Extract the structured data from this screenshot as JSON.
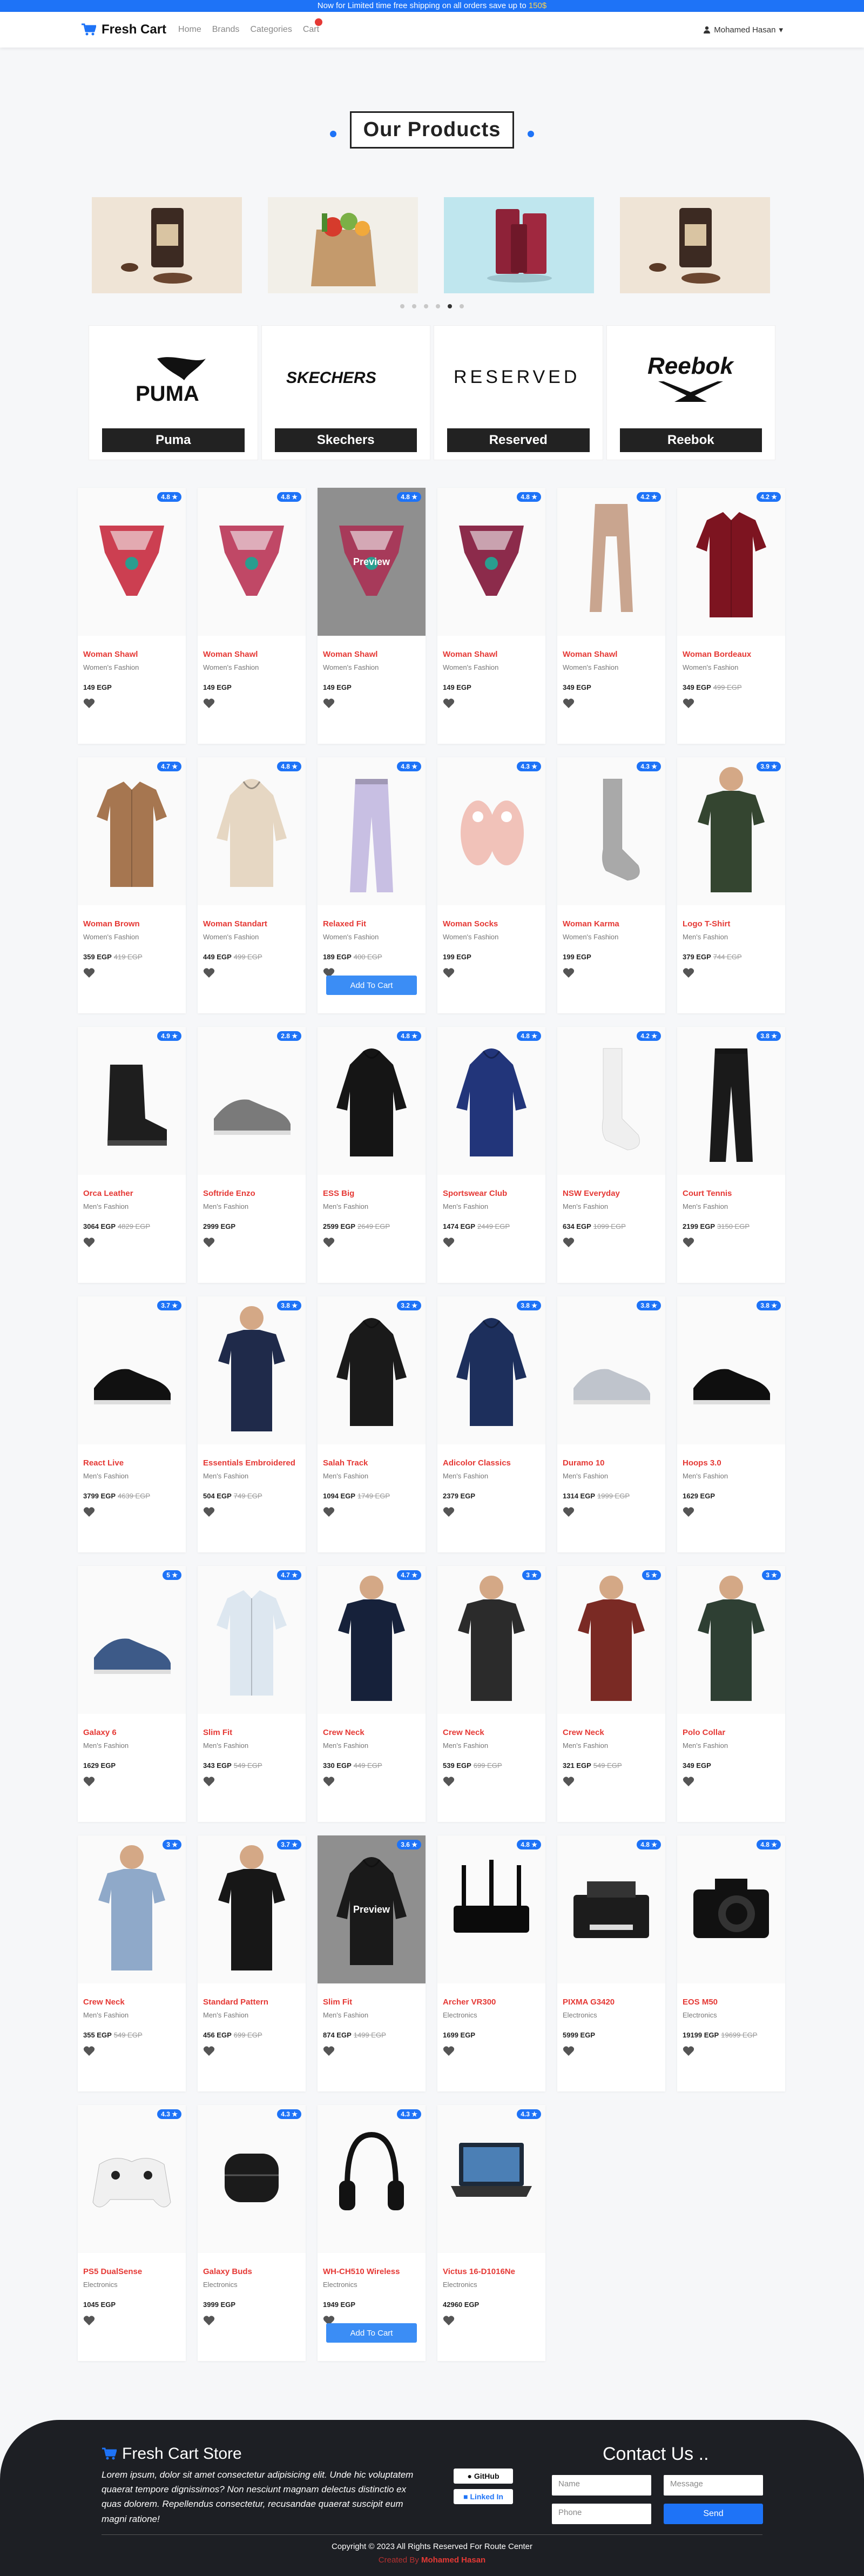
{
  "topbar": {
    "text": "Now for Limited time free shipping on all orders save up to ",
    "highlight": "150$"
  },
  "nav": {
    "brand": "Fresh Cart",
    "links": [
      "Home",
      "Brands",
      "Categories",
      "Cart"
    ],
    "user": "Mohamed Hasan"
  },
  "section_title": "Our Products",
  "slider": {
    "dots": 6,
    "active_dot": 4
  },
  "brands": [
    "Puma",
    "Skechers",
    "Reserved",
    "Reebok"
  ],
  "products": [
    {
      "name": "Woman Shawl",
      "category": "Women's Fashion",
      "price": "149 EGP",
      "old": "",
      "rating": "4.8",
      "kind": "shawl",
      "color": "#cc3f51"
    },
    {
      "name": "Woman Shawl",
      "category": "Women's Fashion",
      "price": "149 EGP",
      "old": "",
      "rating": "4.8",
      "kind": "shawl",
      "color": "#c04866"
    },
    {
      "name": "Woman Shawl",
      "category": "Women's Fashion",
      "price": "149 EGP",
      "old": "",
      "rating": "4.8",
      "kind": "shawl",
      "color": "#a73a5a",
      "preview": true
    },
    {
      "name": "Woman Shawl",
      "category": "Women's Fashion",
      "price": "149 EGP",
      "old": "",
      "rating": "4.8",
      "kind": "shawl",
      "color": "#8c2b4b"
    },
    {
      "name": "Woman Shawl",
      "category": "Women's Fashion",
      "price": "349 EGP",
      "old": "",
      "rating": "4.2",
      "kind": "scarf",
      "color": "#c9a58f"
    },
    {
      "name": "Woman Bordeaux",
      "category": "Women's Fashion",
      "price": "349 EGP",
      "old": "499 EGP",
      "rating": "4.2",
      "kind": "shirt",
      "color": "#7d1420"
    },
    {
      "name": "Woman Brown",
      "category": "Women's Fashion",
      "price": "359 EGP",
      "old": "419 EGP",
      "rating": "4.7",
      "kind": "shirt",
      "color": "#a67650"
    },
    {
      "name": "Woman Standart",
      "category": "Women's Fashion",
      "price": "449 EGP",
      "old": "499 EGP",
      "rating": "4.8",
      "kind": "hoodie",
      "color": "#e6d7c3"
    },
    {
      "name": "Relaxed Fit",
      "category": "Women's Fashion",
      "price": "189 EGP",
      "old": "400 EGP",
      "rating": "4.8",
      "kind": "pants",
      "color": "#c8bfe3",
      "cart": true
    },
    {
      "name": "Woman Socks",
      "category": "Women's Fashion",
      "price": "199 EGP",
      "old": "",
      "rating": "4.3",
      "kind": "slippers",
      "color": "#f1c2b9"
    },
    {
      "name": "Woman Karma",
      "category": "Women's Fashion",
      "price": "199 EGP",
      "old": "",
      "rating": "4.3",
      "kind": "sock",
      "color": "#a9a9a9"
    },
    {
      "name": "Logo T-Shirt",
      "category": "Men's Fashion",
      "price": "379 EGP",
      "old": "744 EGP",
      "rating": "3.9",
      "kind": "tee",
      "color": "#344530"
    },
    {
      "name": "Orca Leather",
      "category": "Men's Fashion",
      "price": "3064 EGP",
      "old": "4829 EGP",
      "rating": "4.9",
      "kind": "boot",
      "color": "#1e1e1e"
    },
    {
      "name": "Softride Enzo",
      "category": "Men's Fashion",
      "price": "2999 EGP",
      "old": "",
      "rating": "2.8",
      "kind": "shoe",
      "color": "#7a7a7a"
    },
    {
      "name": "ESS Big",
      "category": "Men's Fashion",
      "price": "2599 EGP",
      "old": "2649 EGP",
      "rating": "4.8",
      "kind": "hoodie",
      "color": "#151515"
    },
    {
      "name": "Sportswear Club",
      "category": "Men's Fashion",
      "price": "1474 EGP",
      "old": "2449 EGP",
      "rating": "4.8",
      "kind": "hoodie",
      "color": "#22357a"
    },
    {
      "name": "NSW Everyday",
      "category": "Men's Fashion",
      "price": "634 EGP",
      "old": "1099 EGP",
      "rating": "4.2",
      "kind": "sock",
      "color": "#efefef"
    },
    {
      "name": "Court Tennis",
      "category": "Men's Fashion",
      "price": "2199 EGP",
      "old": "3150 EGP",
      "rating": "3.8",
      "kind": "pants",
      "color": "#1a1a1a"
    },
    {
      "name": "React Live",
      "category": "Men's Fashion",
      "price": "3799 EGP",
      "old": "4639 EGP",
      "rating": "3.7",
      "kind": "shoe",
      "color": "#111111"
    },
    {
      "name": "Essentials Embroidered",
      "category": "Men's Fashion",
      "price": "504 EGP",
      "old": "749 EGP",
      "rating": "3.8",
      "kind": "tee",
      "color": "#1f2a4a"
    },
    {
      "name": "Salah Track",
      "category": "Men's Fashion",
      "price": "1094 EGP",
      "old": "1749 EGP",
      "rating": "3.2",
      "kind": "hoodie",
      "color": "#1a1a1a"
    },
    {
      "name": "Adicolor Classics",
      "category": "Men's Fashion",
      "price": "2379 EGP",
      "old": "",
      "rating": "3.8",
      "kind": "hoodie",
      "color": "#1d2f5c"
    },
    {
      "name": "Duramo 10",
      "category": "Men's Fashion",
      "price": "1314 EGP",
      "old": "1999 EGP",
      "rating": "3.8",
      "kind": "shoe",
      "color": "#bfc4cc"
    },
    {
      "name": "Hoops 3.0",
      "category": "Men's Fashion",
      "price": "1629 EGP",
      "old": "",
      "rating": "3.8",
      "kind": "shoe",
      "color": "#0f0f0f"
    },
    {
      "name": "Galaxy 6",
      "category": "Men's Fashion",
      "price": "1629 EGP",
      "old": "",
      "rating": "5",
      "kind": "shoe",
      "color": "#3d5a88"
    },
    {
      "name": "Slim Fit",
      "category": "Men's Fashion",
      "price": "343 EGP",
      "old": "549 EGP",
      "rating": "4.7",
      "kind": "shirt",
      "color": "#dde7f0"
    },
    {
      "name": "Crew Neck",
      "category": "Men's Fashion",
      "price": "330 EGP",
      "old": "449 EGP",
      "rating": "4.7",
      "kind": "tee",
      "color": "#16213a"
    },
    {
      "name": "Crew Neck",
      "category": "Men's Fashion",
      "price": "539 EGP",
      "old": "699 EGP",
      "rating": "3",
      "kind": "tee",
      "color": "#2b2b2b"
    },
    {
      "name": "Crew Neck",
      "category": "Men's Fashion",
      "price": "321 EGP",
      "old": "549 EGP",
      "rating": "5",
      "kind": "tee",
      "color": "#7a2a24"
    },
    {
      "name": "Polo Collar",
      "category": "Men's Fashion",
      "price": "349 EGP",
      "old": "",
      "rating": "3",
      "kind": "tee",
      "color": "#2e3f33"
    },
    {
      "name": "Crew Neck",
      "category": "Men's Fashion",
      "price": "355 EGP",
      "old": "549 EGP",
      "rating": "3",
      "kind": "tee",
      "color": "#8fa9c9"
    },
    {
      "name": "Standard Pattern",
      "category": "Men's Fashion",
      "price": "456 EGP",
      "old": "699 EGP",
      "rating": "3.7",
      "kind": "tee",
      "color": "#171717"
    },
    {
      "name": "Slim Fit",
      "category": "Men's Fashion",
      "price": "874 EGP",
      "old": "1499 EGP",
      "rating": "3.6",
      "kind": "hoodie",
      "color": "#1a1a1a",
      "preview": true
    },
    {
      "name": "Archer VR300",
      "category": "Electronics",
      "price": "1699 EGP",
      "old": "",
      "rating": "4.8",
      "kind": "router",
      "color": "#0b0b0b"
    },
    {
      "name": "PIXMA G3420",
      "category": "Electronics",
      "price": "5999 EGP",
      "old": "",
      "rating": "4.8",
      "kind": "printer",
      "color": "#1c1c1c"
    },
    {
      "name": "EOS M50",
      "category": "Electronics",
      "price": "19199 EGP",
      "old": "19699 EGP",
      "rating": "4.8",
      "kind": "camera",
      "color": "#111111"
    },
    {
      "name": "PS5 DualSense",
      "category": "Electronics",
      "price": "1045 EGP",
      "old": "",
      "rating": "4.3",
      "kind": "controller",
      "color": "#f0f0f0"
    },
    {
      "name": "Galaxy Buds",
      "category": "Electronics",
      "price": "3999 EGP",
      "old": "",
      "rating": "4.3",
      "kind": "buds",
      "color": "#1b1b1b"
    },
    {
      "name": "WH-CH510 Wireless",
      "category": "Electronics",
      "price": "1949 EGP",
      "old": "",
      "rating": "4.3",
      "kind": "headphones",
      "color": "#121212",
      "cart": true
    },
    {
      "name": "Victus 16-D1016Ne",
      "category": "Electronics",
      "price": "42960 EGP",
      "old": "",
      "rating": "4.3",
      "kind": "laptop",
      "color": "#1d2a3a"
    }
  ],
  "ui": {
    "preview": "Preview",
    "add_to_cart": "Add To Cart",
    "star": "★"
  },
  "footer": {
    "title": "Fresh Cart Store",
    "text": "Lorem ipsum, dolor sit amet consectetur adipisicing elit. Unde hic voluptatem quaerat tempore dignissimos? Non nesciunt magnam delectus distinctio ex quas dolorem. Repellendus consectetur, recusandae quaerat suscipit eum magni ratione!",
    "github": "GitHub",
    "linkedin": "Linked In",
    "contact_title": "Contact Us ..",
    "name_placeholder": "Name",
    "message_placeholder": "Message",
    "phone_placeholder": "Phone",
    "send": "Send",
    "copyright": "Copyright © 2023 All Rights Reserved For Route Center",
    "credit_prefix": "Created By ",
    "credit_name": "Mohamed Hasan"
  }
}
